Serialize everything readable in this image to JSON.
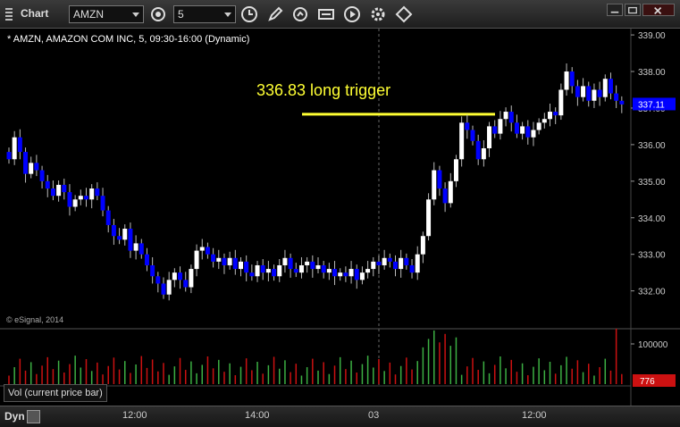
{
  "toolbar": {
    "app_label": "Chart",
    "symbol": "AMZN",
    "interval": "5"
  },
  "chart": {
    "symbol_label": "* AMZN, AMAZON COM INC, 5, 09:30-16:00 (Dynamic)",
    "copyright": "© eSignal, 2014",
    "trigger_annotation": "336.83 long trigger",
    "trigger_level": 336.83,
    "last_price_label": "337.11",
    "volume_label": "Vol (current price bar)",
    "volume_tick": "100000",
    "volume_last_label": "776",
    "y_ticks": [
      "339.00",
      "338.00",
      "337.00",
      "336.00",
      "335.00",
      "334.00",
      "333.00",
      "332.00"
    ],
    "x_ticks": [
      "12:00",
      "14:00",
      "03",
      "12:00"
    ],
    "colors": {
      "up": "#ffffff",
      "down": "#0000ff",
      "trigger": "#ffff33",
      "price_tag": "#0000ff",
      "vol_up": "#3cb043",
      "vol_down": "#cc1111"
    }
  },
  "chart_data": {
    "type": "candlestick",
    "ylim": [
      331.6,
      339.1
    ],
    "ohlc_closes": [
      335.6,
      336.2,
      335.8,
      335.2,
      335.5,
      335.3,
      335.0,
      334.8,
      334.6,
      334.9,
      334.7,
      334.3,
      334.5,
      334.6,
      334.5,
      334.8,
      334.6,
      334.2,
      333.8,
      333.5,
      333.4,
      333.7,
      333.1,
      333.3,
      333.0,
      332.7,
      332.4,
      332.2,
      331.9,
      332.3,
      332.5,
      332.3,
      332.1,
      332.6,
      333.1,
      333.2,
      333.0,
      332.8,
      332.9,
      332.7,
      332.9,
      332.6,
      332.8,
      332.5,
      332.4,
      332.7,
      332.5,
      332.6,
      332.4,
      332.7,
      332.9,
      332.6,
      332.5,
      332.7,
      332.8,
      332.6,
      332.7,
      332.5,
      332.6,
      332.4,
      332.5,
      332.4,
      332.6,
      332.3,
      332.5,
      332.6,
      332.8,
      332.7,
      332.9,
      332.8,
      332.6,
      332.9,
      332.7,
      332.5,
      333.0,
      333.5,
      334.5,
      335.3,
      334.8,
      334.4,
      335.0,
      335.6,
      336.6,
      336.4,
      336.1,
      335.6,
      335.9,
      336.5,
      336.3,
      336.7,
      336.9,
      336.6,
      336.3,
      336.5,
      336.2,
      336.4,
      336.6,
      336.7,
      336.9,
      336.8,
      337.5,
      338.0,
      337.6,
      337.3,
      337.6,
      337.2,
      337.5,
      337.3,
      337.8,
      337.4,
      337.2,
      337.1
    ],
    "volume_max": 130000
  }
}
